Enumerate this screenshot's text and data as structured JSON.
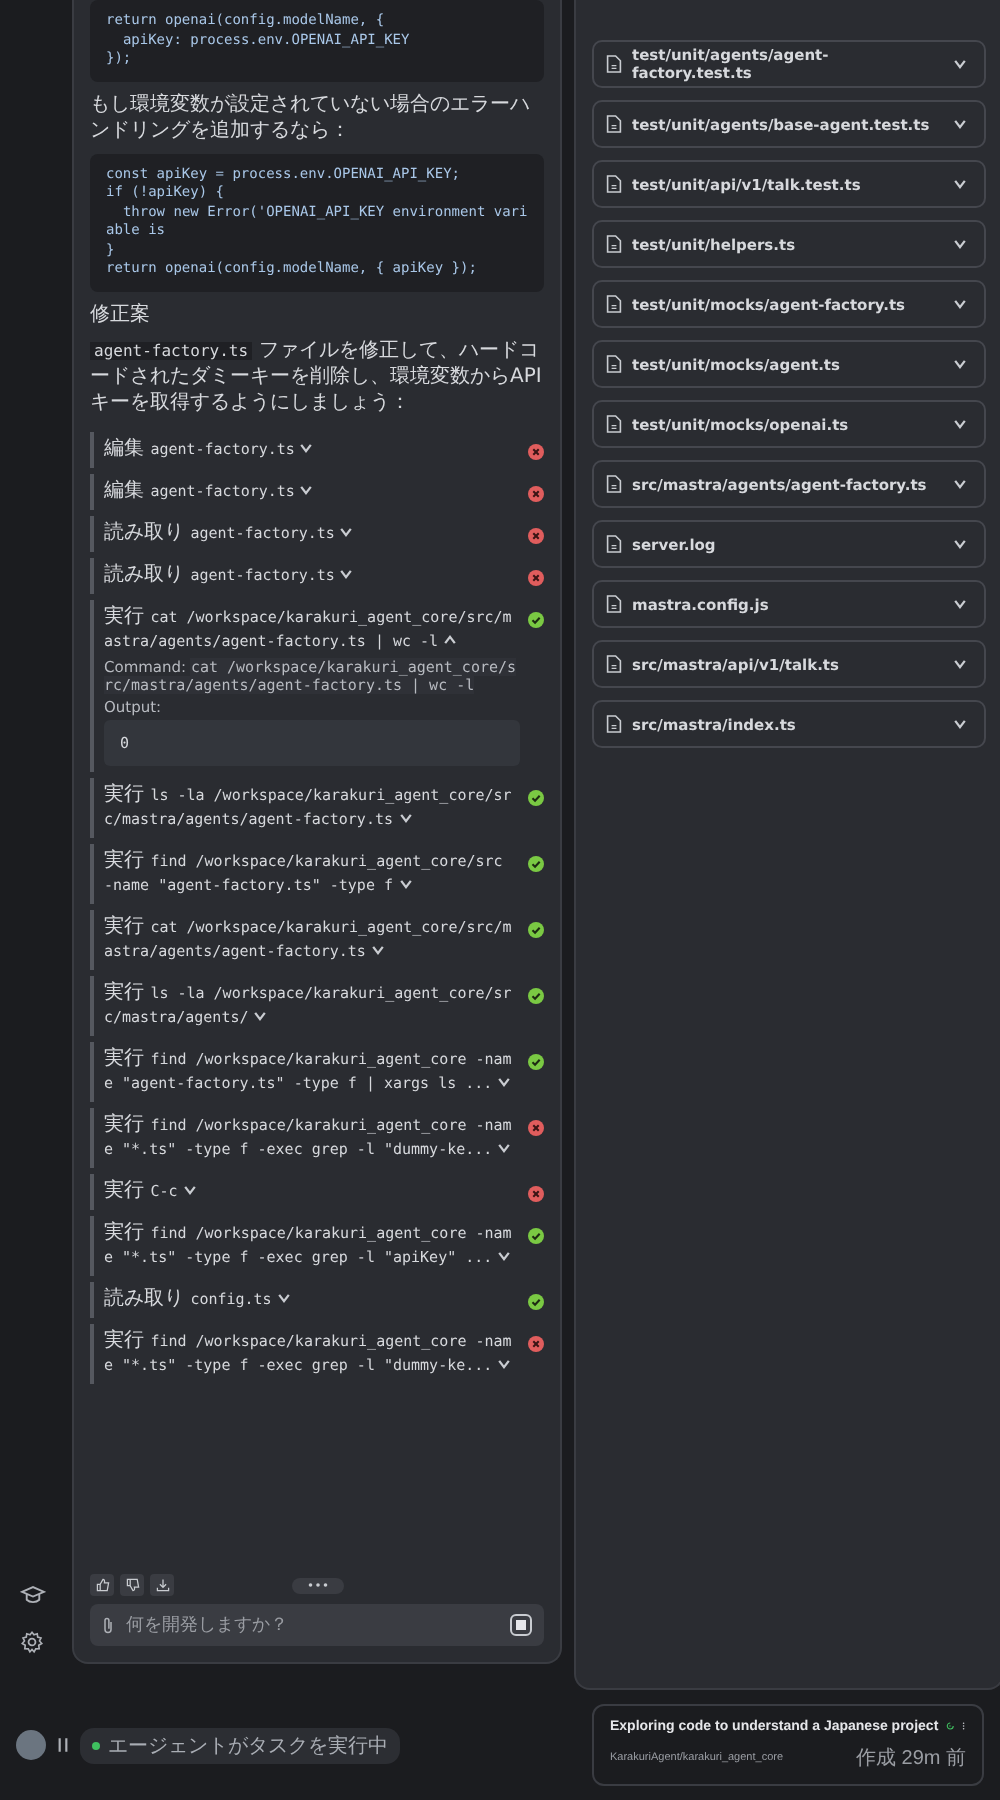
{
  "chat": {
    "messages": [
      {
        "kind": "code",
        "lines": [
          "return openai(config.modelName, {",
          "  apiKey: process.env.OPENAI_API_KEY",
          "});"
        ]
      },
      {
        "kind": "text",
        "text": "もし環境変数が設定されていない場合のエラーハンドリングを追加するなら："
      },
      {
        "kind": "code",
        "lines": [
          "const apiKey = process.env.OPENAI_API_KEY;",
          "if (!apiKey) {",
          "  throw new Error('OPENAI_API_KEY environment variable is",
          "}",
          "return openai(config.modelName, { apiKey });"
        ]
      },
      {
        "kind": "heading",
        "text": "修正案"
      },
      {
        "kind": "inline_code_text",
        "code": "agent-factory.ts",
        "text": "ファイルを修正して、ハードコードされたダミーキーを削除し、環境変数からAPIキーを取得するようにしましょう："
      }
    ],
    "tools": [
      {
        "verb": "編集",
        "target": "agent-factory.ts",
        "success": false,
        "expanded": false
      },
      {
        "verb": "編集",
        "target": "agent-factory.ts",
        "success": false,
        "expanded": false
      },
      {
        "verb": "読み取り",
        "target": "agent-factory.ts",
        "success": false,
        "expanded": false
      },
      {
        "verb": "読み取り",
        "target": "agent-factory.ts",
        "success": false,
        "expanded": false
      },
      {
        "verb": "実行",
        "target": "cat /workspace/karakuri_agent_core/src/mastra/agents/agent-factory.ts | wc -l",
        "success": true,
        "expanded": true,
        "command_label": "Command:",
        "command": "cat /workspace/karakuri_agent_core/src/mastra/agents/agent-factory.ts | wc -l",
        "output_label": "Output:",
        "output": "0"
      },
      {
        "verb": "実行",
        "target": "ls -la /workspace/karakuri_agent_core/src/mastra/agents/agent-factory.ts",
        "success": true,
        "expanded": false
      },
      {
        "verb": "実行",
        "target": "find /workspace/karakuri_agent_core/src -name \"agent-factory.ts\" -type f",
        "success": true,
        "expanded": false
      },
      {
        "verb": "実行",
        "target": "cat /workspace/karakuri_agent_core/src/mastra/agents/agent-factory.ts",
        "success": true,
        "expanded": false
      },
      {
        "verb": "実行",
        "target": "ls -la /workspace/karakuri_agent_core/src/mastra/agents/",
        "success": true,
        "expanded": false
      },
      {
        "verb": "実行",
        "target": "find /workspace/karakuri_agent_core -name \"agent-factory.ts\" -type f | xargs ls ...",
        "success": true,
        "expanded": false
      },
      {
        "verb": "実行",
        "target": "find /workspace/karakuri_agent_core -name \"*.ts\" -type f -exec grep -l \"dummy-ke...",
        "success": false,
        "expanded": false
      },
      {
        "verb": "実行",
        "target": "C-c",
        "success": false,
        "expanded": false
      },
      {
        "verb": "実行",
        "target": "find /workspace/karakuri_agent_core -name \"*.ts\" -type f -exec grep -l \"apiKey\" ...",
        "success": true,
        "expanded": false
      },
      {
        "verb": "読み取り",
        "target": "config.ts",
        "success": true,
        "expanded": false
      },
      {
        "verb": "実行",
        "target": "find /workspace/karakuri_agent_core -name \"*.ts\" -type f -exec grep -l \"dummy-ke...",
        "success": false,
        "expanded": false
      }
    ],
    "input": {
      "placeholder": "何を開発しますか？"
    }
  },
  "files": [
    {
      "path": "test/unit/agents/agent-factory.test.ts"
    },
    {
      "path": "test/unit/agents/base-agent.test.ts"
    },
    {
      "path": "test/unit/api/v1/talk.test.ts"
    },
    {
      "path": "test/unit/helpers.ts"
    },
    {
      "path": "test/unit/mocks/agent-factory.ts"
    },
    {
      "path": "test/unit/mocks/agent.ts"
    },
    {
      "path": "test/unit/mocks/openai.ts"
    },
    {
      "path": "src/mastra/agents/agent-factory.ts"
    },
    {
      "path": "server.log"
    },
    {
      "path": "mastra.config.js"
    },
    {
      "path": "src/mastra/api/v1/talk.ts"
    },
    {
      "path": "src/mastra/index.ts"
    }
  ],
  "status_bar": {
    "agent_status": "エージェントがタスクを実行中"
  },
  "task": {
    "title": "Exploring code to understand a Japanese project",
    "repo": "KarakuriAgent/karakuri_agent_core",
    "created": "作成 29m 前"
  }
}
